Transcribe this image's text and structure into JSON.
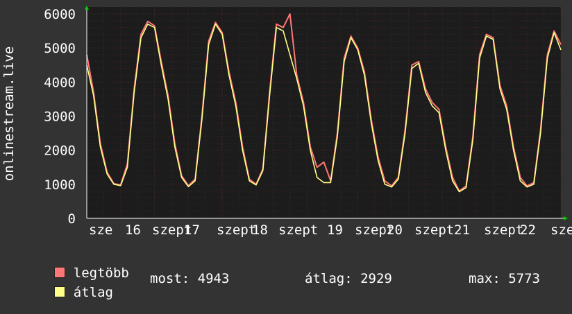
{
  "chart_data": {
    "type": "line",
    "ylabel": "onlinestream.live",
    "ylim": [
      0,
      6000
    ],
    "yticks": [
      0,
      1000,
      2000,
      3000,
      4000,
      5000,
      6000
    ],
    "xtick_labels": [
      "sze 16",
      "szept 17",
      "szept 18",
      "szept 19",
      "szept 20",
      "szept 21",
      "szept 22",
      "sze"
    ],
    "xtick_labels_rendered": [
      "sze",
      "16",
      "szept",
      "17",
      "szept",
      "18",
      "szept",
      "19",
      "szept",
      "20",
      "szept",
      "21",
      "szept",
      "22",
      "sze"
    ],
    "grid": true,
    "colors": {
      "background": "#333333",
      "plot_background": "#1c1c1c",
      "grid_major": "#4a2a2a",
      "axis": "#ffffff",
      "arrow": "#00cc00",
      "max_series": "#ff7777",
      "avg_series": "#ffff88"
    },
    "series": [
      {
        "name": "legtöbb",
        "color": "#ff7777",
        "x": [
          0,
          0.1,
          0.2,
          0.3,
          0.4,
          0.5,
          0.6,
          0.7,
          0.8,
          0.9,
          1.0,
          1.1,
          1.2,
          1.3,
          1.4,
          1.5,
          1.6,
          1.7,
          1.8,
          1.9,
          2.0,
          2.1,
          2.2,
          2.3,
          2.4,
          2.5,
          2.6,
          2.7,
          2.8,
          2.9,
          3.0,
          3.1,
          3.2,
          3.3,
          3.4,
          3.5,
          3.6,
          3.7,
          3.8,
          3.9,
          4.0,
          4.1,
          4.2,
          4.3,
          4.4,
          4.5,
          4.6,
          4.7,
          4.8,
          4.9,
          5.0,
          5.1,
          5.2,
          5.3,
          5.4,
          5.5,
          5.6,
          5.7,
          5.8,
          5.9,
          6.0,
          6.1,
          6.2,
          6.3,
          6.4,
          6.5,
          6.6,
          6.7,
          6.8,
          6.9,
          7.0
        ],
        "values": [
          4800,
          3700,
          2200,
          1350,
          1020,
          980,
          1600,
          3800,
          5400,
          5780,
          5650,
          4600,
          3600,
          2200,
          1250,
          960,
          1150,
          3000,
          5200,
          5750,
          5450,
          4300,
          3400,
          2100,
          1150,
          1000,
          1450,
          3700,
          5700,
          5600,
          6000,
          4200,
          3400,
          2100,
          1500,
          1650,
          1100,
          2500,
          4700,
          5350,
          5000,
          4300,
          2900,
          1800,
          1100,
          950,
          1200,
          2600,
          4500,
          4600,
          3800,
          3400,
          3200,
          2100,
          1200,
          800,
          950,
          2400,
          4800,
          5400,
          5300,
          3900,
          3300,
          2100,
          1200,
          950,
          1050,
          2600,
          4800,
          5500,
          5100
        ]
      },
      {
        "name": "átlag",
        "color": "#ffff88",
        "x": [
          0,
          0.1,
          0.2,
          0.3,
          0.4,
          0.5,
          0.6,
          0.7,
          0.8,
          0.9,
          1.0,
          1.1,
          1.2,
          1.3,
          1.4,
          1.5,
          1.6,
          1.7,
          1.8,
          1.9,
          2.0,
          2.1,
          2.2,
          2.3,
          2.4,
          2.5,
          2.6,
          2.7,
          2.8,
          2.9,
          3.0,
          3.1,
          3.2,
          3.3,
          3.4,
          3.5,
          3.6,
          3.7,
          3.8,
          3.9,
          4.0,
          4.1,
          4.2,
          4.3,
          4.4,
          4.5,
          4.6,
          4.7,
          4.8,
          4.9,
          5.0,
          5.1,
          5.2,
          5.3,
          5.4,
          5.5,
          5.6,
          5.7,
          5.8,
          5.9,
          6.0,
          6.1,
          6.2,
          6.3,
          6.4,
          6.5,
          6.6,
          6.7,
          6.8,
          6.9,
          7.0
        ],
        "values": [
          4500,
          3600,
          2100,
          1300,
          1000,
          960,
          1500,
          3700,
          5300,
          5700,
          5600,
          4500,
          3500,
          2100,
          1200,
          930,
          1100,
          2900,
          5100,
          5700,
          5400,
          4200,
          3300,
          2000,
          1100,
          980,
          1400,
          3600,
          5600,
          5500,
          4800,
          4100,
          3300,
          2000,
          1200,
          1050,
          1050,
          2400,
          4600,
          5300,
          4950,
          4200,
          2800,
          1700,
          1000,
          920,
          1150,
          2500,
          4400,
          4550,
          3700,
          3300,
          3100,
          2000,
          1100,
          780,
          900,
          2300,
          4700,
          5350,
          5250,
          3800,
          3200,
          2000,
          1100,
          920,
          1000,
          2500,
          4700,
          5450,
          4943
        ]
      }
    ]
  },
  "legend": {
    "max_label": "legtöbb",
    "avg_label": "átlag"
  },
  "stats": {
    "now": "most: 4943",
    "avg": "átlag: 2929",
    "max": "max: 5773"
  }
}
